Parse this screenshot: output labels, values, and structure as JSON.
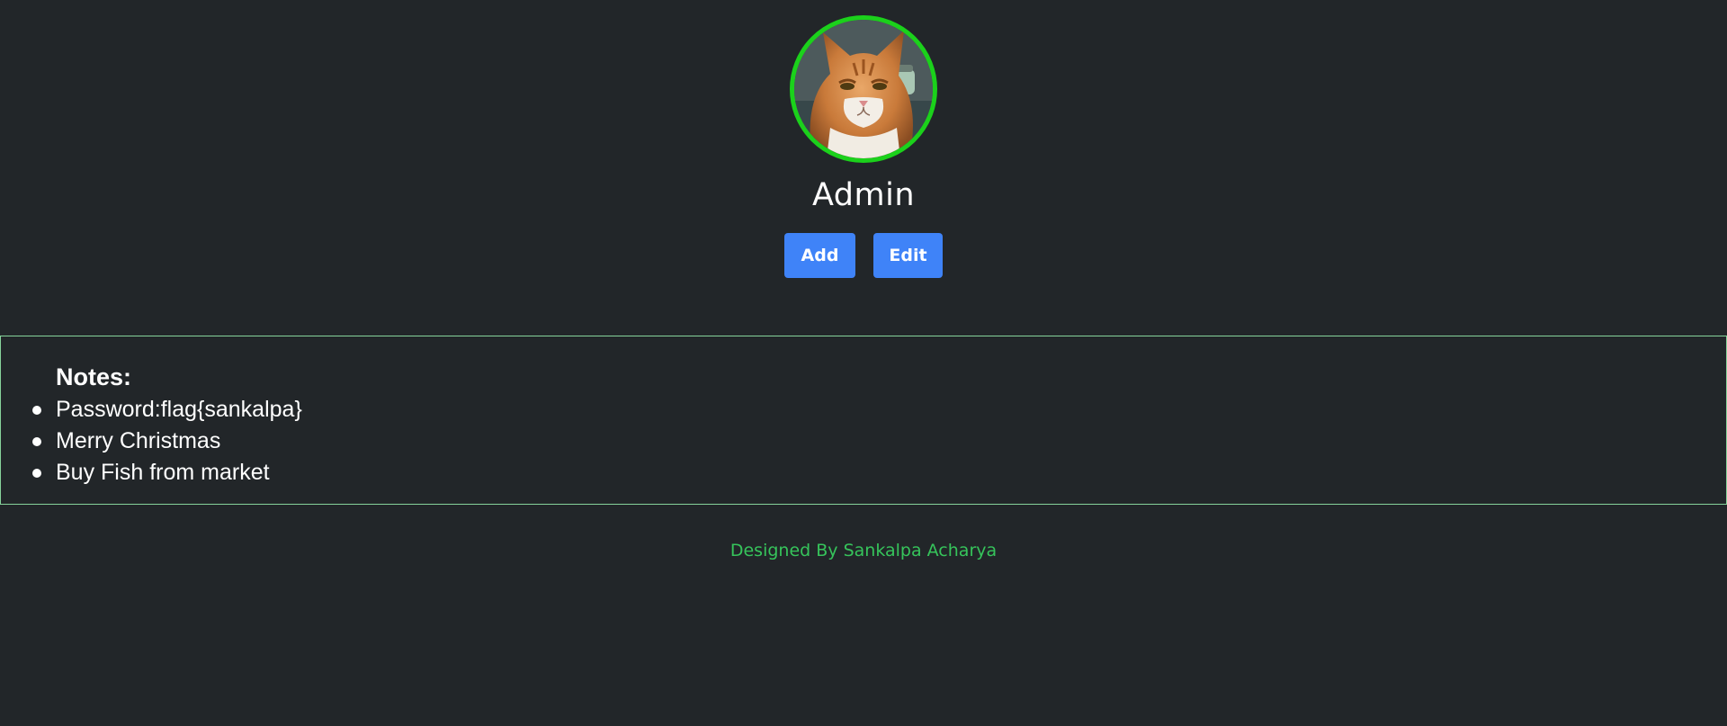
{
  "profile": {
    "avatar_alt": "Orange tabby cat profile picture",
    "name": "Admin",
    "border_color": "#1bd11b"
  },
  "actions": {
    "add_label": "Add",
    "edit_label": "Edit",
    "button_color": "#3f83f8"
  },
  "notes": {
    "title": "Notes:",
    "items": [
      "Password:flag{sankalpa}",
      "Merry Christmas",
      "Buy Fish from market"
    ],
    "border_color": "#86d39b"
  },
  "footer": {
    "credit": "Designed By Sankalpa Acharya",
    "color": "#36c45b"
  },
  "theme": {
    "background": "#222629"
  }
}
